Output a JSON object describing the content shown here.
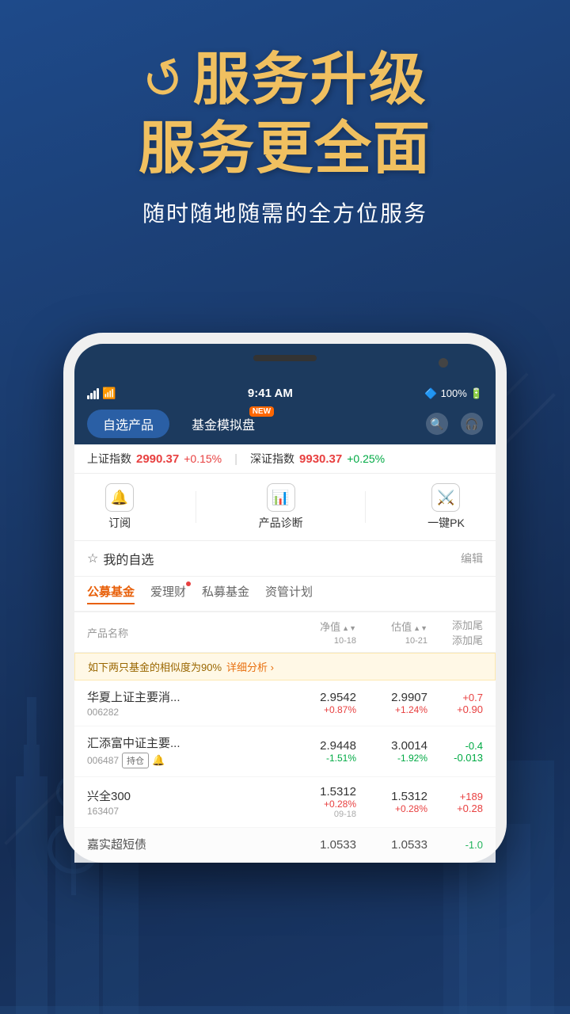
{
  "hero": {
    "arrow_symbol": "↗",
    "title_line1": "服务升级",
    "title_line2": "服务更全面",
    "subtitle": "随时随地随需的全方位服务"
  },
  "status_bar": {
    "time": "9:41 AM",
    "battery": "100%",
    "signal": "●●●"
  },
  "tabs": {
    "tab1": "自选产品",
    "tab2": "基金模拟盘",
    "new_badge": "NEW"
  },
  "ticker": {
    "sh_name": "上证指数",
    "sh_value": "2990.37",
    "sh_change": "+0.15%",
    "sz_name": "深证指数",
    "sz_value": "9930.37",
    "sz_change": "+0.25%"
  },
  "actions": {
    "subscribe": "订阅",
    "diagnose": "产品诊断",
    "pk": "一键PK"
  },
  "watchlist": {
    "title": "我的自选",
    "edit": "编辑"
  },
  "categories": {
    "cat1": "公募基金",
    "cat2": "爱理财",
    "cat3": "私募基金",
    "cat4": "资管计划"
  },
  "table_header": {
    "name": "产品名称",
    "nav": "净值",
    "nav_date": "10-18",
    "est": "估值",
    "est_date": "10-21",
    "add": "添加尾\n添加尾"
  },
  "alert": {
    "text": "如下两只基金的相似度为90%",
    "link": "详细分析 ›"
  },
  "funds": [
    {
      "name": "华夏上证主要消...",
      "code": "006282",
      "nav_val": "2.9542",
      "nav_chg": "+0.87%",
      "nav_chg_color": "red",
      "est_val": "2.9907",
      "est_chg": "+1.24%",
      "est_chg_color": "red",
      "action_val": "+0.7",
      "action_val2": "+0.90"
    },
    {
      "name": "汇添富中证主要...",
      "code": "006487",
      "badge": "持仓",
      "has_bell": true,
      "nav_val": "2.9448",
      "nav_chg": "-1.51%",
      "nav_chg_color": "green",
      "est_val": "3.0014",
      "est_chg": "-1.92%",
      "est_chg_color": "green",
      "action_val": "-0.4",
      "action_val2": "-0.013"
    },
    {
      "name": "兴全300",
      "code": "163407",
      "nav_val": "1.5312",
      "nav_chg": "+0.28%",
      "nav_chg_color": "red",
      "est_val": "1.5312",
      "est_chg": "+0.28%",
      "est_chg_color": "red",
      "nav_date": "09-18",
      "action_val": "+189",
      "action_val2": "+0.28"
    },
    {
      "name": "嘉实超短债",
      "code": "",
      "nav_val": "1.0533",
      "nav_chg": "",
      "est_val": "1.0533",
      "est_chg": "",
      "action_val": "-1.0"
    }
  ]
}
